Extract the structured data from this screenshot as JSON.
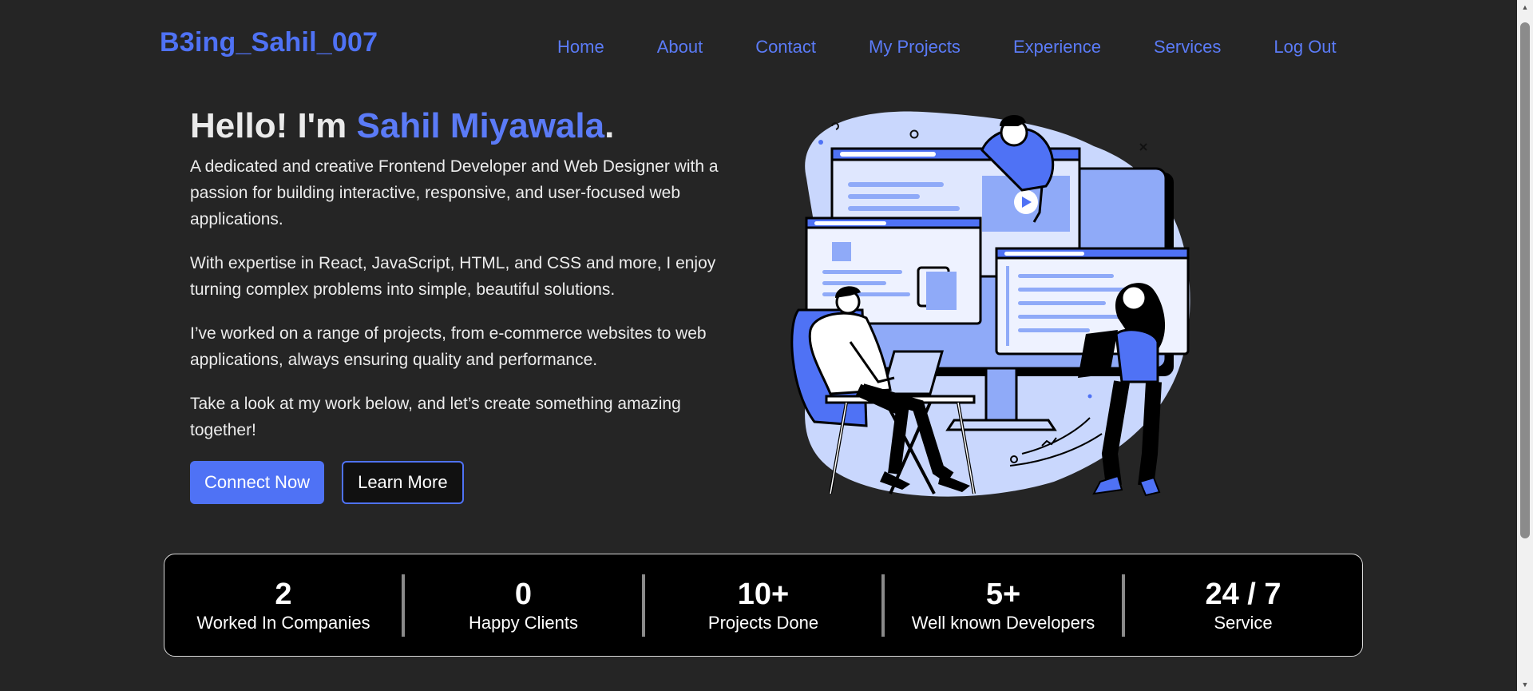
{
  "nav": {
    "brand": "B3ing_Sahil_007",
    "links": [
      "Home",
      "About",
      "Contact",
      "My Projects",
      "Experience",
      "Services",
      "Log Out"
    ]
  },
  "hero": {
    "greeting": "Hello! I'm",
    "name": "Sahil Miyawala",
    "period": ".",
    "paragraphs": [
      "A dedicated and creative Frontend Developer and Web Designer with a passion for building interactive, responsive, and user-focused web applications.",
      "With expertise in React, JavaScript, HTML, and CSS and more, I enjoy turning complex problems into simple, beautiful solutions.",
      "I’ve worked on a range of projects, from e-commerce websites to web applications, always ensuring quality and performance.",
      "Take a look at my work below, and let’s create something amazing together!"
    ],
    "primary_button": "Connect Now",
    "secondary_button": "Learn More"
  },
  "stats": [
    {
      "value": "2",
      "label": "Worked In Companies"
    },
    {
      "value": "0",
      "label": "Happy Clients"
    },
    {
      "value": "10+",
      "label": "Projects Done"
    },
    {
      "value": "5+",
      "label": "Well known Developers"
    },
    {
      "value": "24 / 7",
      "label": "Service"
    }
  ],
  "colors": {
    "accent": "#4f72f5",
    "background": "#252525",
    "illustration_light": "#c9d7fd",
    "illustration_mid": "#8faaf8"
  }
}
